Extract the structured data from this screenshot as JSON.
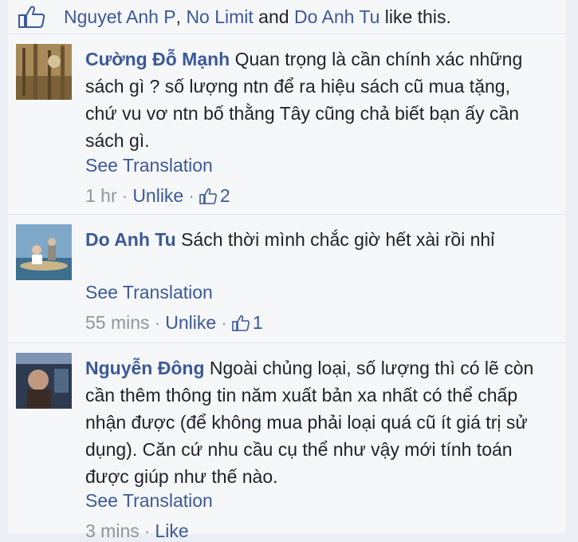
{
  "likes": {
    "names": [
      "Nguyet Anh P",
      "No Limit",
      "Do Anh Tu"
    ],
    "sep1": ", ",
    "sep2": " and ",
    "suffix": " like this."
  },
  "comments": [
    {
      "author": "Cường Đỗ Mạnh",
      "text": "Quan trọng là cần chính xác những sách gì ? số lượng ntn để ra hiệu sách cũ mua tặng, chứ vu vơ ntn bố thằng Tây cũng chả biết bạn ấy cần sách gì.",
      "translate": "See Translation",
      "time": "1 hr",
      "action": "Unlike",
      "like_count": "2"
    },
    {
      "author": "Do Anh Tu",
      "text": "Sách thời mình chắc giờ hết xài rồi nhỉ",
      "translate": "See Translation",
      "time": "55 mins",
      "action": "Unlike",
      "like_count": "1"
    },
    {
      "author": "Nguyễn Đông",
      "text": "Ngoài chủng loại, số lượng thì có lẽ còn cần thêm thông tin năm xuất bản xa nhất có thể chấp nhận được (để không mua phải loại quá cũ ít giá trị sử dụng). Căn cứ nhu cầu cụ thể như vậy mới tính toán được giúp như thế nào.",
      "translate": "See Translation",
      "time": "3 mins",
      "action": "Like"
    }
  ],
  "colors": {
    "link": "#3b5998",
    "meta": "#90949c",
    "background": "#ebeef4",
    "card": "#f6f7f9"
  },
  "icons": [
    "thumbs-up-icon"
  ]
}
